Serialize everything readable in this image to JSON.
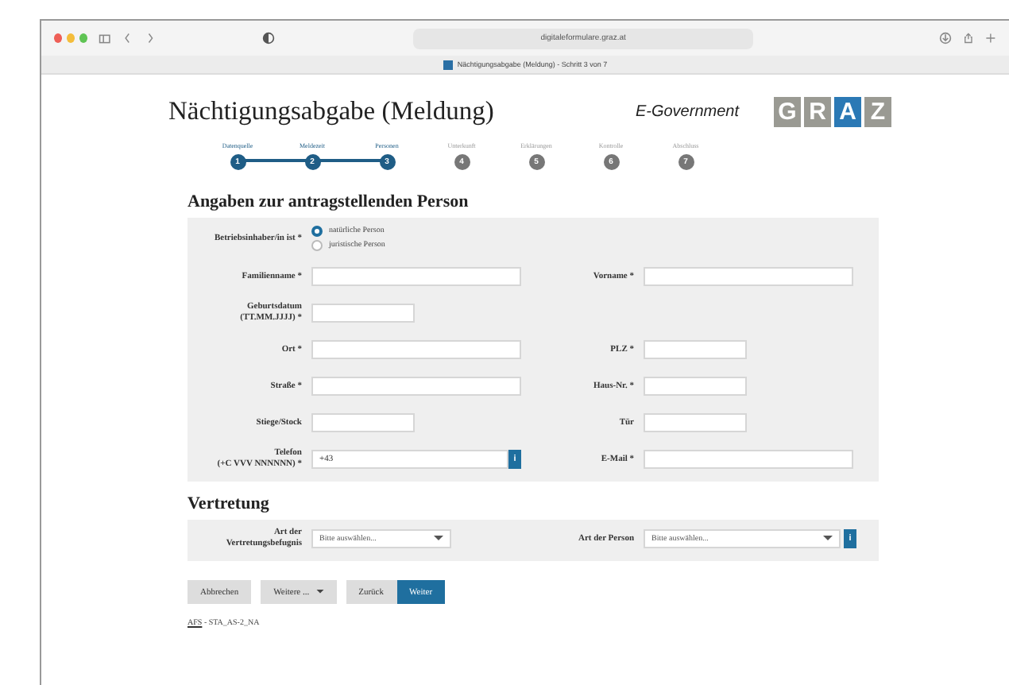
{
  "browser": {
    "url": "digitaleformulare.graz.at",
    "tab_title": "Nächtigungsabgabe (Meldung) - Schritt 3 von 7"
  },
  "header": {
    "title": "Nächtigungsabgabe (Meldung)",
    "subtitle": "E-Government",
    "logo": [
      {
        "letter": "G",
        "selected": false
      },
      {
        "letter": "R",
        "selected": false
      },
      {
        "letter": "A",
        "selected": true
      },
      {
        "letter": "Z",
        "selected": false
      }
    ]
  },
  "steps": [
    {
      "label": "Datenquelle",
      "number": "1",
      "done": true
    },
    {
      "label": "Meldezeit",
      "number": "2",
      "done": true
    },
    {
      "label": "Personen",
      "number": "3",
      "done": true
    },
    {
      "label": "Unterkunft",
      "number": "4",
      "done": false
    },
    {
      "label": "Erklärungen",
      "number": "5",
      "done": false
    },
    {
      "label": "Kontrolle",
      "number": "6",
      "done": false
    },
    {
      "label": "Abschluss",
      "number": "7",
      "done": false
    }
  ],
  "sections": [
    {
      "title": "Angaben zur antragstellenden Person",
      "rows": [
        {
          "cells": [
            {
              "kind": "radio",
              "label": [
                "Betriebsinhaber/in ist *"
              ],
              "options": [
                {
                  "label": "natürliche Person",
                  "selected": true
                },
                {
                  "label": "juristische Person",
                  "selected": false
                }
              ]
            }
          ]
        },
        {
          "cells": [
            {
              "kind": "wide",
              "label": [
                "Familienname *"
              ]
            },
            {
              "kind": "wide",
              "label": [
                "Vorname *"
              ]
            }
          ]
        },
        {
          "cells": [
            {
              "kind": "short",
              "label": [
                "Geburtsdatum",
                "(TT.MM.JJJJ) *"
              ]
            }
          ]
        },
        {
          "cells": [
            {
              "kind": "wide",
              "label": [
                "Ort *"
              ]
            },
            {
              "kind": "short",
              "label": [
                "PLZ *"
              ]
            }
          ]
        },
        {
          "cells": [
            {
              "kind": "wide",
              "label": [
                "Straße *"
              ]
            },
            {
              "kind": "short",
              "label": [
                "Haus-Nr. *"
              ]
            }
          ]
        },
        {
          "cells": [
            {
              "kind": "short",
              "label": [
                "Stiege/Stock"
              ]
            },
            {
              "kind": "short",
              "label": [
                "Tür"
              ]
            }
          ]
        },
        {
          "cells": [
            {
              "kind": "info",
              "label": [
                "Telefon",
                "(+C VVV NNNNNN) *"
              ],
              "value": "+43",
              "info": "i"
            },
            {
              "kind": "wide",
              "label": [
                "E-Mail *"
              ]
            }
          ]
        }
      ]
    },
    {
      "title": "Vertretung",
      "rows": [
        {
          "cells": [
            {
              "kind": "select",
              "label": [
                "Art der",
                "Vertretungsbefugnis"
              ],
              "placeholder": "Bitte auswählen..."
            },
            {
              "kind": "select-info",
              "label": [
                "Art der Person"
              ],
              "placeholder": "Bitte auswählen...",
              "info": "i"
            }
          ]
        }
      ]
    }
  ],
  "buttons": [
    {
      "label": "Abbrechen",
      "kind": "plain"
    },
    {
      "label": "Weitere ...",
      "kind": "menu"
    },
    {
      "label": "Zurück",
      "kind": "plain"
    },
    {
      "label": "Weiter",
      "kind": "primary"
    }
  ],
  "footer": {
    "link": "AFS",
    "text": " - STA_AS-2_NA"
  }
}
